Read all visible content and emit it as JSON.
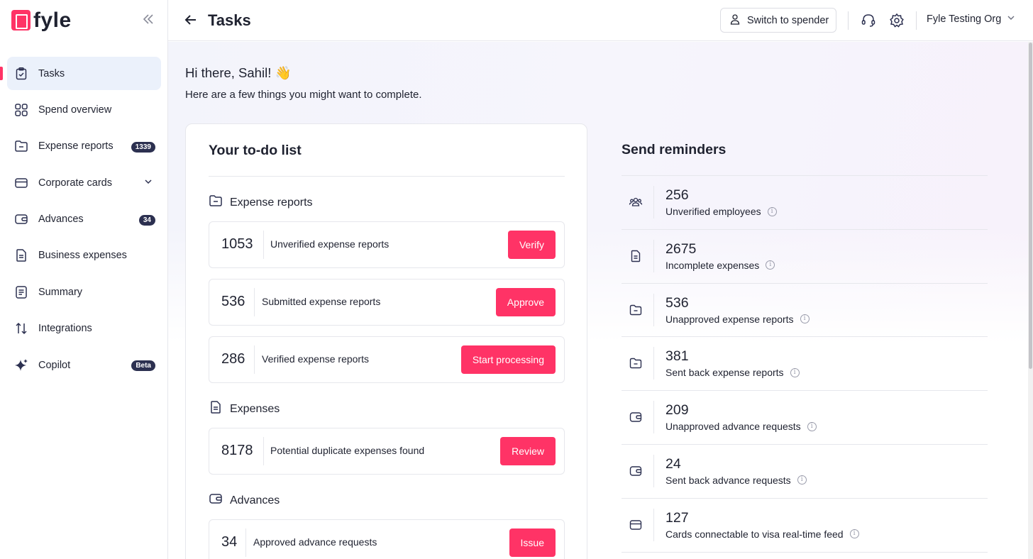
{
  "brand": {
    "name": "fyle",
    "accent": "#ff3366"
  },
  "sidebar": {
    "items": [
      {
        "label": "Tasks",
        "icon": "clipboard-check-icon",
        "active": true
      },
      {
        "label": "Spend overview",
        "icon": "grid-icon"
      },
      {
        "label": "Expense reports",
        "icon": "folder-icon",
        "badge": "1339"
      },
      {
        "label": "Corporate cards",
        "icon": "card-icon",
        "chevron": true
      },
      {
        "label": "Advances",
        "icon": "wallet-icon",
        "badge": "34"
      },
      {
        "label": "Business expenses",
        "icon": "document-icon"
      },
      {
        "label": "Summary",
        "icon": "list-icon"
      },
      {
        "label": "Integrations",
        "icon": "arrows-icon"
      },
      {
        "label": "Copilot",
        "icon": "sparkle-icon",
        "badge": "Beta"
      }
    ]
  },
  "header": {
    "title": "Tasks",
    "switch_label": "Switch to spender",
    "org_name": "Fyle Testing Org"
  },
  "main": {
    "greeting": "Hi there, Sahil! 👋",
    "subtitle": "Here are a few things you might want to complete.",
    "todo": {
      "title": "Your to-do list",
      "sections": [
        {
          "title": "Expense reports",
          "rows": [
            {
              "count": "1053",
              "label": "Unverified expense reports",
              "action": "Verify"
            },
            {
              "count": "536",
              "label": "Submitted expense reports",
              "action": "Approve"
            },
            {
              "count": "286",
              "label": "Verified expense reports",
              "action": "Start processing"
            }
          ]
        },
        {
          "title": "Expenses",
          "rows": [
            {
              "count": "8178",
              "label": "Potential duplicate expenses found",
              "action": "Review"
            }
          ]
        },
        {
          "title": "Advances",
          "rows": [
            {
              "count": "34",
              "label": "Approved advance requests",
              "action": "Issue"
            }
          ]
        }
      ]
    },
    "reminders": {
      "title": "Send reminders",
      "items": [
        {
          "count": "256",
          "label": "Unverified employees",
          "icon": "users-icon"
        },
        {
          "count": "2675",
          "label": "Incomplete expenses",
          "icon": "document-icon"
        },
        {
          "count": "536",
          "label": "Unapproved expense reports",
          "icon": "folder-icon"
        },
        {
          "count": "381",
          "label": "Sent back expense reports",
          "icon": "folder-icon"
        },
        {
          "count": "209",
          "label": "Unapproved advance requests",
          "icon": "wallet-icon"
        },
        {
          "count": "24",
          "label": "Sent back advance requests",
          "icon": "wallet-icon"
        },
        {
          "count": "127",
          "label": "Cards connectable to visa real-time feed",
          "icon": "card-icon"
        }
      ]
    }
  }
}
